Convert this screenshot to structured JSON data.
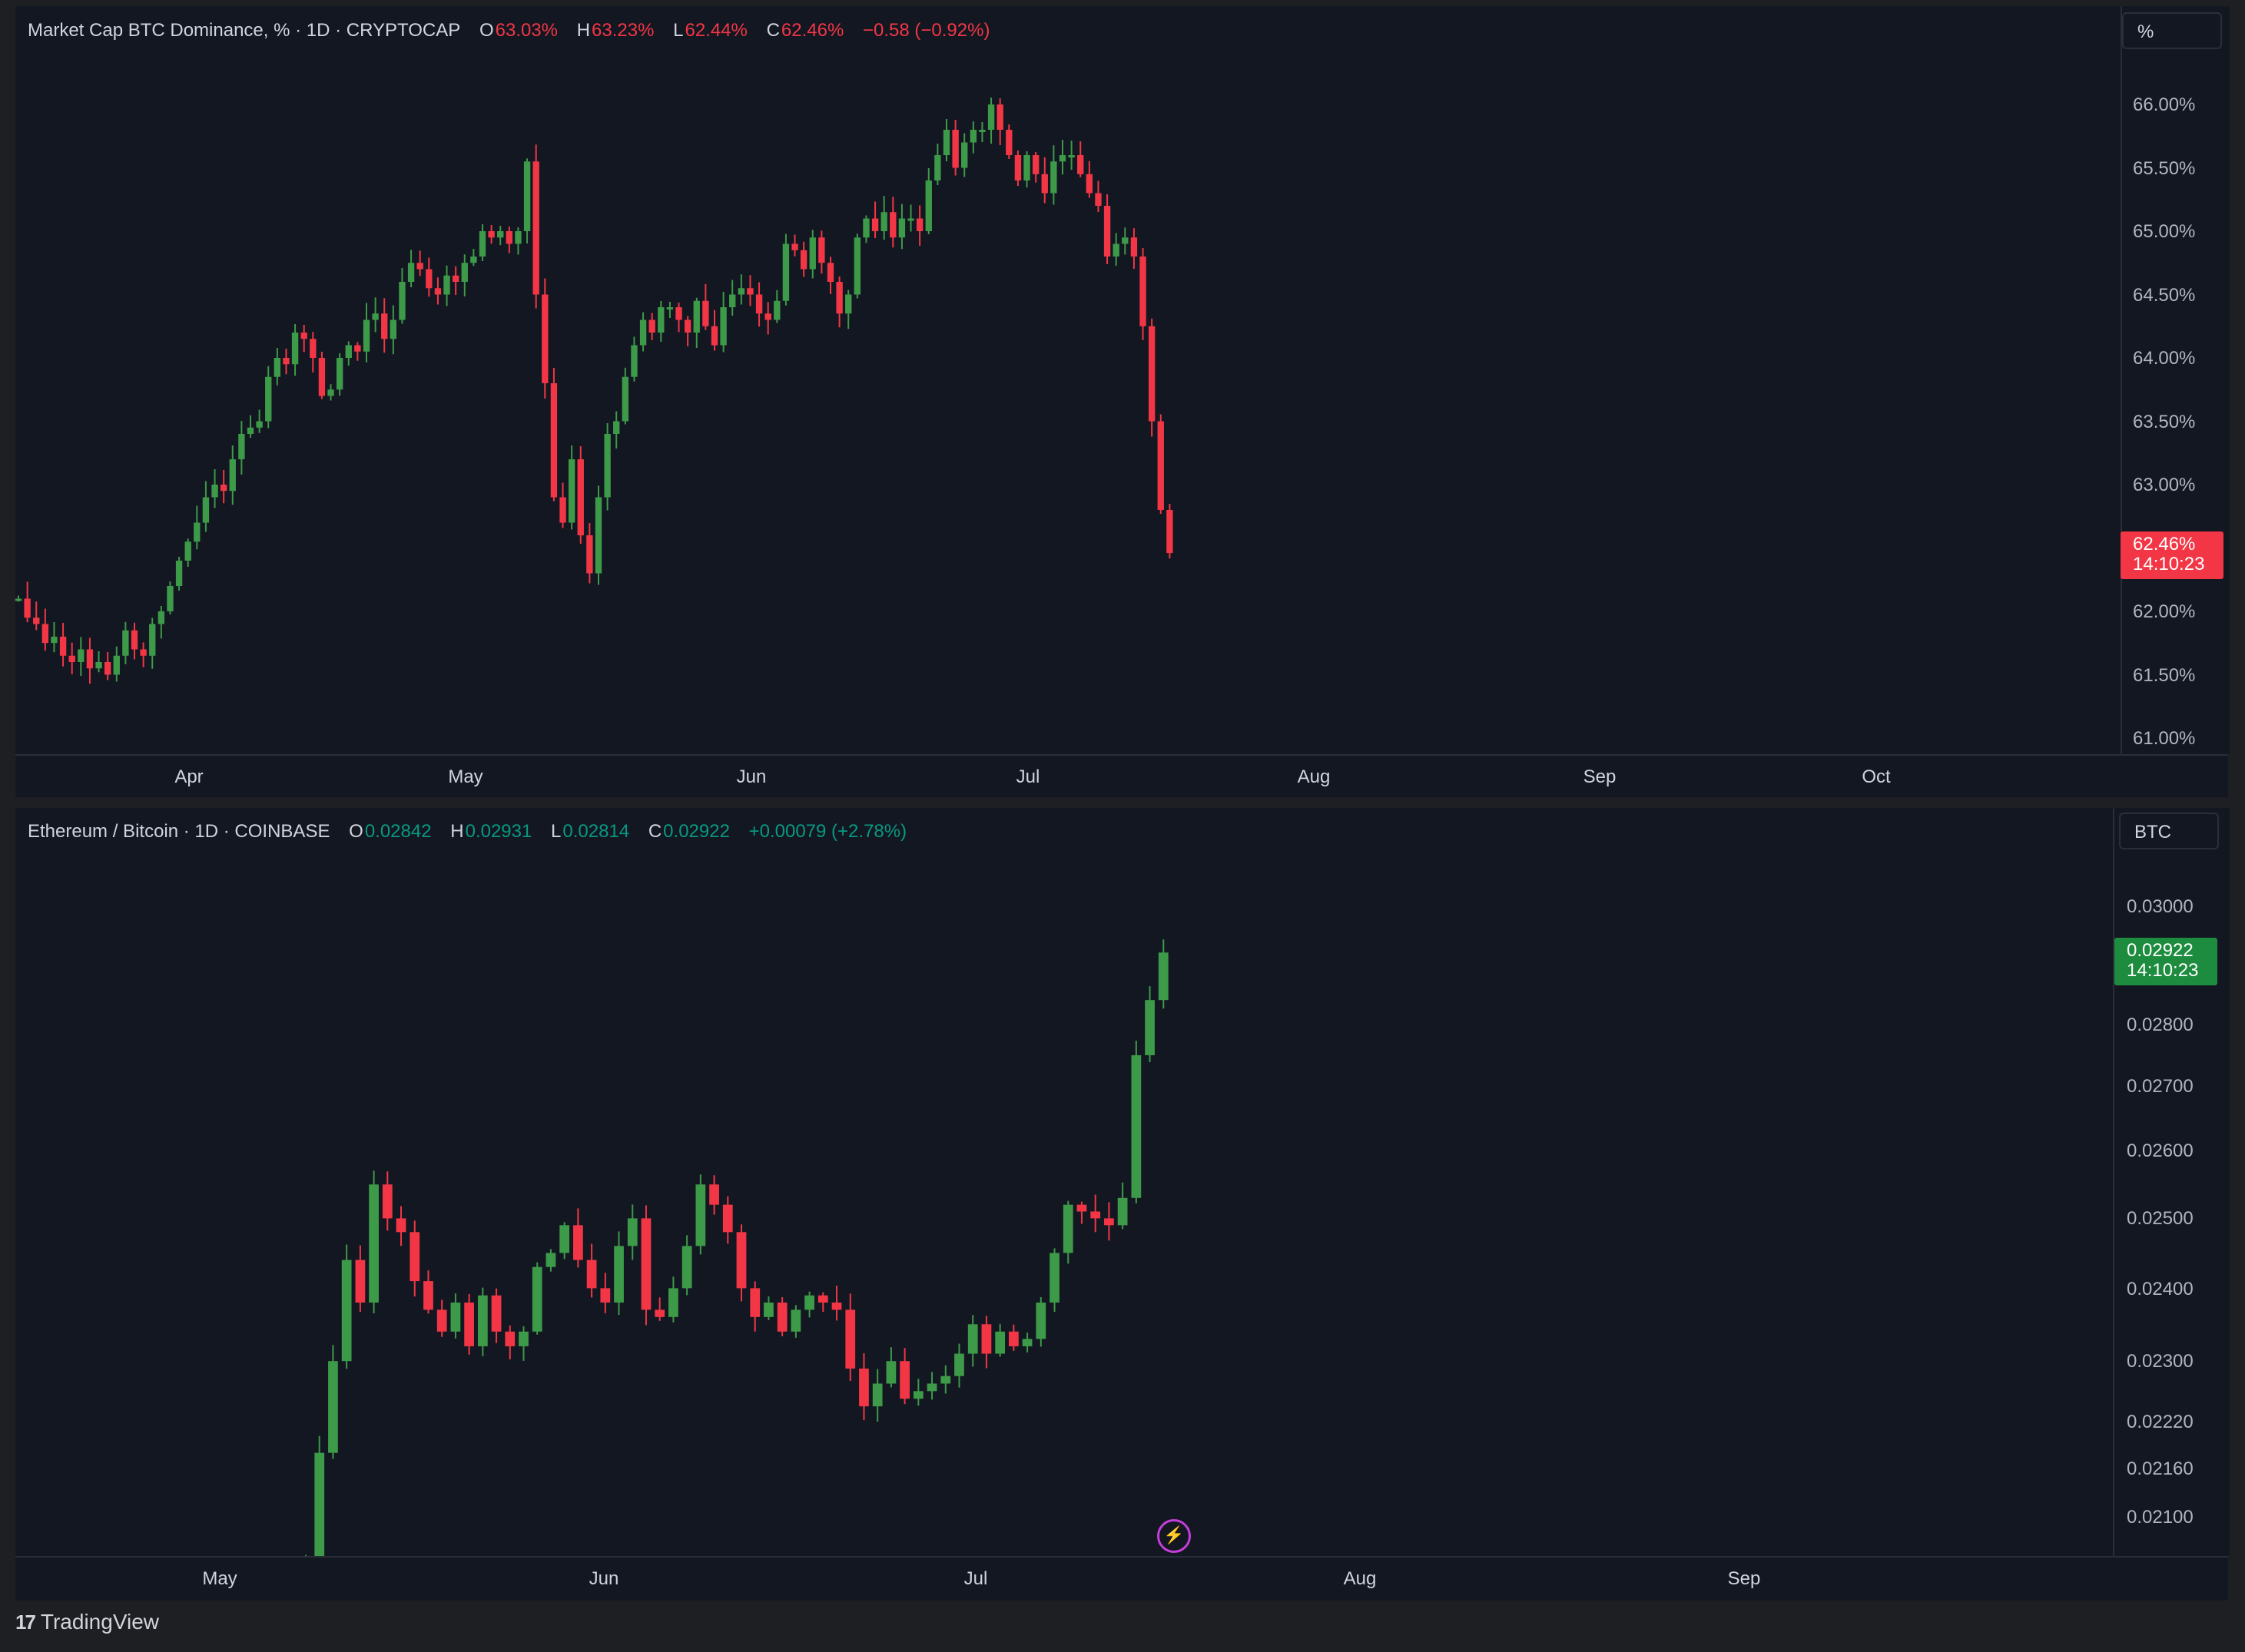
{
  "colors": {
    "up": "#22ab94",
    "up_fill": "#3d9a48",
    "down": "#f23645",
    "bg": "#131722",
    "grid": "#2a2e39"
  },
  "top_pane": {
    "legend": {
      "name": "Market Cap BTC Dominance, % · 1D · CRYPTOCAP",
      "o_lab": "O",
      "o": "63.03%",
      "h_lab": "H",
      "h": "63.23%",
      "l_lab": "L",
      "l": "62.44%",
      "c_lab": "C",
      "c": "62.46%",
      "change": "−0.58 (−0.92%)"
    },
    "unit_button": "%",
    "y_ticks": [
      "66.00%",
      "65.50%",
      "65.00%",
      "64.50%",
      "64.00%",
      "63.50%",
      "63.00%",
      "62.00%",
      "61.50%",
      "61.00%"
    ],
    "last_price": "62.46%",
    "countdown": "14:10:23",
    "x_ticks": [
      "Apr",
      "May",
      "Jun",
      "Jul",
      "Aug",
      "Sep",
      "Oct"
    ]
  },
  "bottom_pane": {
    "legend": {
      "name": "Ethereum / Bitcoin · 1D · COINBASE",
      "o_lab": "O",
      "o": "0.02842",
      "h_lab": "H",
      "h": "0.02931",
      "l_lab": "L",
      "l": "0.02814",
      "c_lab": "C",
      "c": "0.02922",
      "change": "+0.00079 (+2.78%)"
    },
    "unit_button": "BTC",
    "y_ticks": [
      "0.03000",
      "0.02800",
      "0.02700",
      "0.02600",
      "0.02500",
      "0.02400",
      "0.02300",
      "0.02220",
      "0.02160",
      "0.02100"
    ],
    "last_price": "0.02922",
    "countdown": "14:10:23",
    "x_ticks": [
      "May",
      "Jun",
      "Jul",
      "Aug",
      "Sep"
    ]
  },
  "brand": {
    "logo": "17",
    "name": "TradingView"
  },
  "icons": {
    "flash": "lightning-icon"
  },
  "chart_data": [
    {
      "type": "candlestick",
      "title": "Market Cap BTC Dominance, % · 1D · CRYPTOCAP",
      "x_axis": [
        "Apr",
        "May",
        "Jun",
        "Jul",
        "Aug",
        "Sep",
        "Oct"
      ],
      "ylim": [
        60.8,
        66.3
      ],
      "y_unit": "%",
      "closes": [
        62.1,
        61.95,
        61.9,
        61.75,
        61.8,
        61.65,
        61.6,
        61.7,
        61.55,
        61.6,
        61.5,
        61.65,
        61.85,
        61.7,
        61.65,
        61.9,
        62.0,
        62.2,
        62.4,
        62.55,
        62.7,
        62.9,
        63.0,
        62.95,
        63.2,
        63.4,
        63.45,
        63.5,
        63.85,
        64.0,
        63.95,
        64.2,
        64.15,
        64.0,
        63.7,
        63.75,
        64.0,
        64.1,
        64.05,
        64.3,
        64.35,
        64.15,
        64.3,
        64.6,
        64.75,
        64.7,
        64.55,
        64.5,
        64.65,
        64.6,
        64.75,
        64.8,
        65.0,
        64.95,
        65.0,
        64.9,
        65.0,
        65.55,
        64.5,
        63.8,
        62.9,
        62.7,
        63.2,
        62.6,
        62.3,
        62.9,
        63.4,
        63.5,
        63.85,
        64.1,
        64.3,
        64.2,
        64.4,
        64.4,
        64.3,
        64.2,
        64.45,
        64.25,
        64.1,
        64.4,
        64.5,
        64.55,
        64.5,
        64.35,
        64.3,
        64.45,
        64.9,
        64.85,
        64.7,
        64.95,
        64.75,
        64.6,
        64.35,
        64.5,
        64.95,
        65.1,
        65.0,
        65.15,
        64.95,
        65.1,
        65.1,
        65.0,
        65.4,
        65.6,
        65.8,
        65.5,
        65.7,
        65.8,
        65.8,
        66.0,
        65.8,
        65.6,
        65.4,
        65.6,
        65.45,
        65.3,
        65.55,
        65.6,
        65.6,
        65.45,
        65.3,
        65.2,
        64.8,
        64.9,
        64.95,
        64.8,
        64.25,
        63.5,
        62.8,
        62.46
      ]
    },
    {
      "type": "candlestick",
      "title": "Ethereum / Bitcoin · 1D · COINBASE",
      "x_axis": [
        "May",
        "Jun",
        "Jul",
        "Aug",
        "Sep"
      ],
      "ylim": [
        0.0205,
        0.0305
      ],
      "y_unit": "BTC",
      "closes": [
        0.0205,
        0.0218,
        0.023,
        0.0244,
        0.0238,
        0.0255,
        0.025,
        0.0248,
        0.0241,
        0.0237,
        0.0234,
        0.0238,
        0.0232,
        0.0239,
        0.0234,
        0.0232,
        0.0234,
        0.0243,
        0.0245,
        0.0249,
        0.0244,
        0.024,
        0.0238,
        0.0246,
        0.025,
        0.0237,
        0.0236,
        0.024,
        0.0246,
        0.0255,
        0.0252,
        0.0248,
        0.024,
        0.0236,
        0.0238,
        0.0234,
        0.0237,
        0.0239,
        0.0238,
        0.0237,
        0.0229,
        0.0224,
        0.0227,
        0.023,
        0.0225,
        0.0226,
        0.0227,
        0.0228,
        0.0231,
        0.0235,
        0.0231,
        0.0234,
        0.0232,
        0.0233,
        0.0238,
        0.0245,
        0.0252,
        0.0251,
        0.025,
        0.0249,
        0.0253,
        0.0275,
        0.0284,
        0.0292
      ]
    }
  ]
}
